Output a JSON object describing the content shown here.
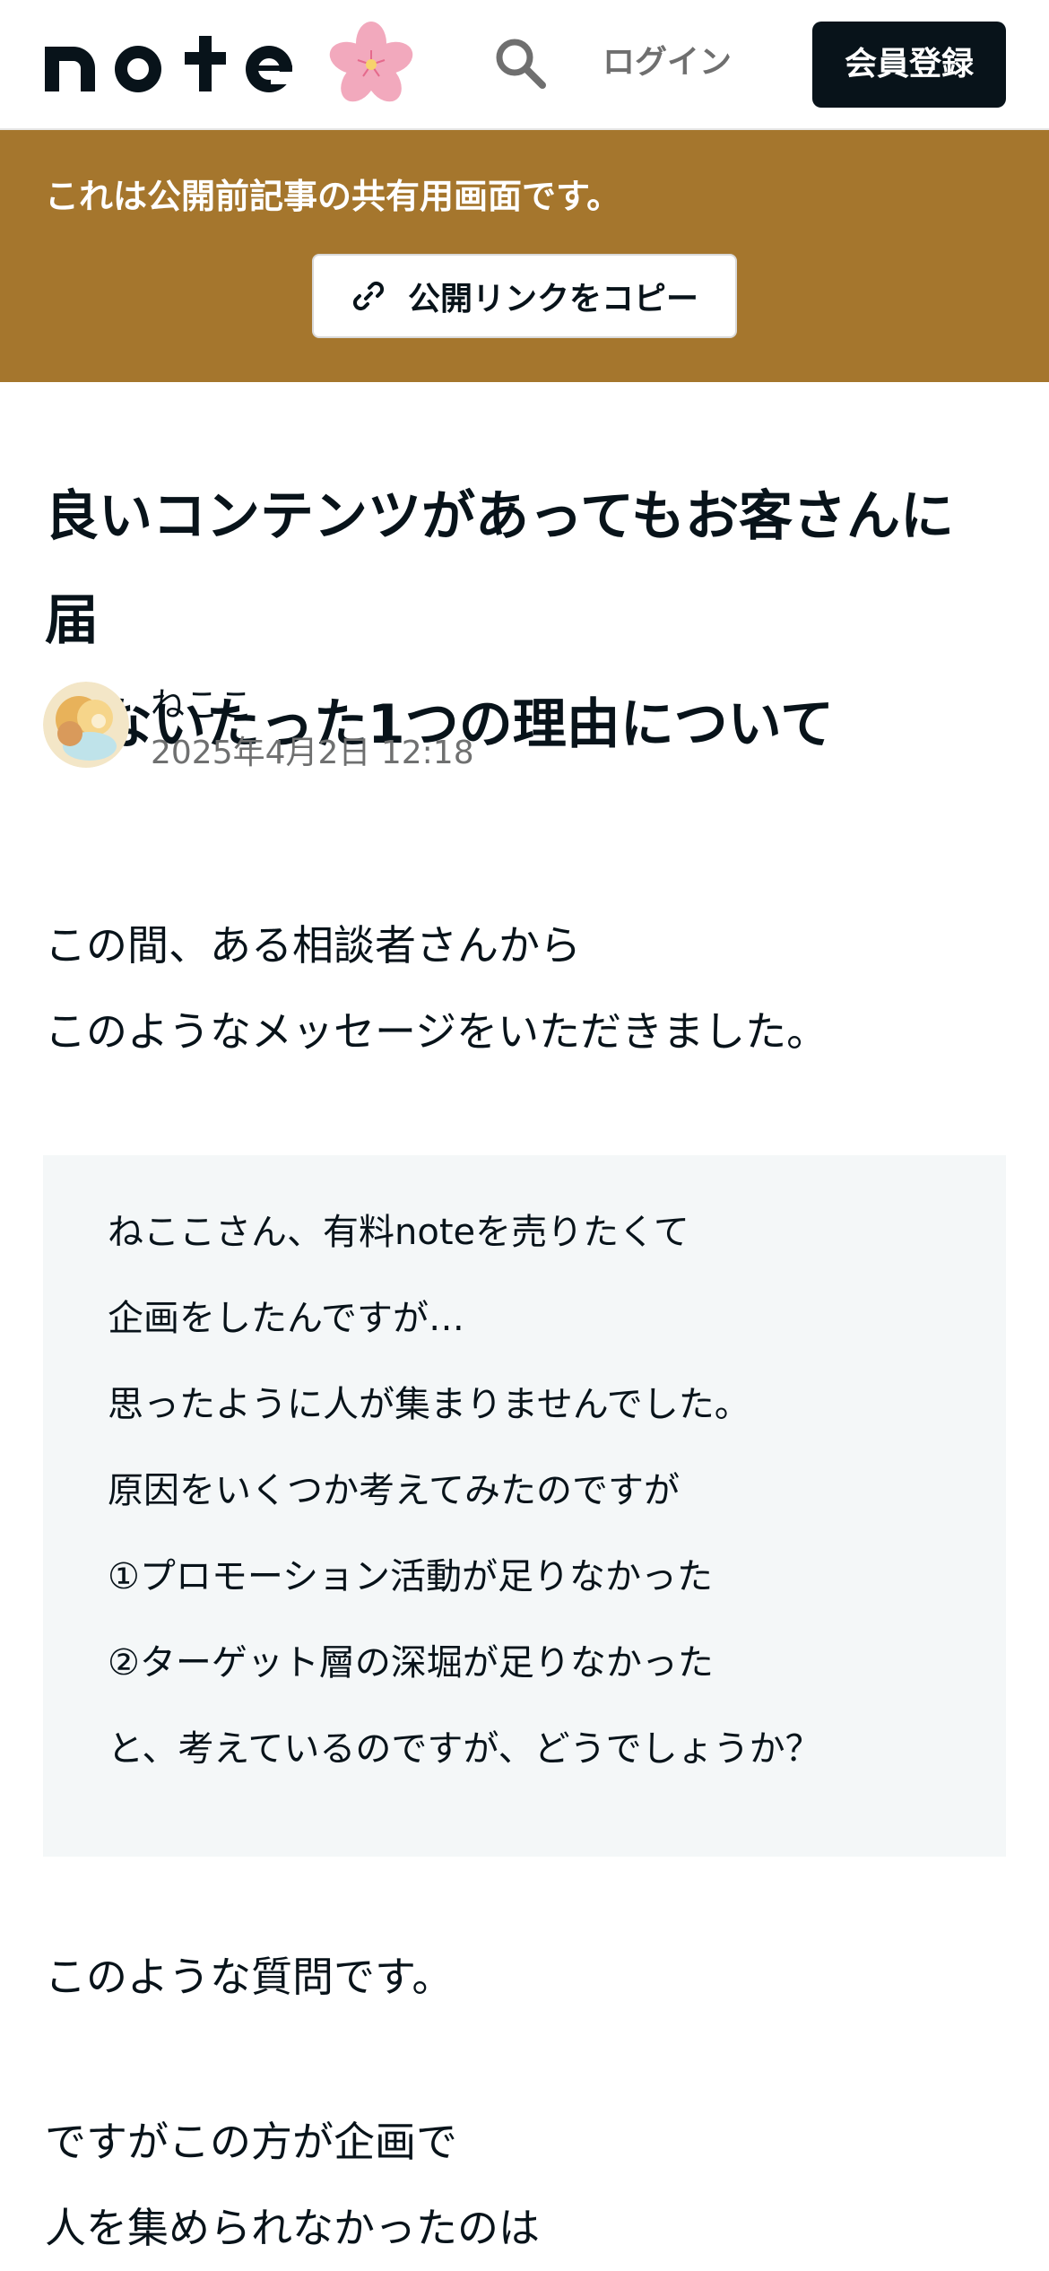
{
  "header": {
    "logo_text": "note",
    "login_label": "ログイン",
    "signup_label": "会員登録"
  },
  "share_banner": {
    "message": "これは公開前記事の共有用画面です。",
    "copy_link_label": "公開リンクをコピー",
    "background_color": "#a5762d"
  },
  "article": {
    "title_lines": [
      "良いコンテンツがあってもお客さんに届",
      "かないたった1つの理由について"
    ],
    "author_name": "ねここ",
    "published_at": "2025年4月2日 12:18",
    "intro_lines": [
      "この間、ある相談者さんから",
      "このようなメッセージをいただきました。"
    ],
    "quote_lines": [
      "ねここさん、有料noteを売りたくて",
      "企画をしたんですが…",
      "思ったように人が集まりませんでした。",
      "原因をいくつか考えてみたのですが",
      "①プロモーション活動が足りなかった",
      "②ターゲット層の深堀が足りなかった",
      "と、考えているのですが、どうでしょうか？"
    ],
    "after_quote": "このような質問です。",
    "continuation_lines": [
      "ですがこの方が企画で",
      "人を集められなかったのは"
    ]
  }
}
